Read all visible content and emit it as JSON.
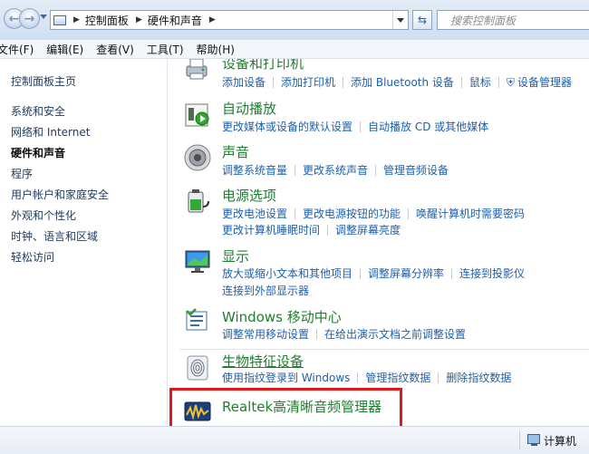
{
  "address": {
    "breadcrumbs": [
      "控制面板",
      "硬件和声音"
    ],
    "search_placeholder": "搜索控制面板"
  },
  "menu": [
    "文件(F)",
    "编辑(E)",
    "查看(V)",
    "工具(T)",
    "帮助(H)"
  ],
  "sidebar": {
    "items": [
      {
        "label": "控制面板主页"
      },
      {
        "label": "系统和安全"
      },
      {
        "label": "网络和 Internet"
      },
      {
        "label": "硬件和声音",
        "active": true
      },
      {
        "label": "程序"
      },
      {
        "label": "用户帐户和家庭安全"
      },
      {
        "label": "外观和个性化"
      },
      {
        "label": "时钟、语言和区域"
      },
      {
        "label": "轻松访问"
      }
    ]
  },
  "categories": [
    {
      "title": "设备和打印机",
      "icon": "printer-icon",
      "rows": [
        [
          "添加设备",
          "添加打印机",
          "添加 Bluetooth 设备",
          "鼠标",
          "设备管理器"
        ]
      ]
    },
    {
      "title": "自动播放",
      "icon": "autoplay-icon",
      "rows": [
        [
          "更改媒体或设备的默认设置",
          "自动播放 CD 或其他媒体"
        ]
      ]
    },
    {
      "title": "声音",
      "icon": "speaker-icon",
      "rows": [
        [
          "调整系统音量",
          "更改系统声音",
          "管理音频设备"
        ]
      ]
    },
    {
      "title": "电源选项",
      "icon": "battery-icon",
      "rows": [
        [
          "更改电池设置",
          "更改电源按钮的功能",
          "唤醒计算机时需要密码"
        ],
        [
          "更改计算机睡眠时间",
          "调整屏幕亮度"
        ]
      ]
    },
    {
      "title": "显示",
      "icon": "monitor-icon",
      "rows": [
        [
          "放大或缩小文本和其他项目",
          "调整屏幕分辨率",
          "连接到投影仪"
        ],
        [
          "连接到外部显示器"
        ]
      ]
    },
    {
      "title": "Windows 移动中心",
      "icon": "mobility-center-icon",
      "rows": [
        [
          "调整常用移动设置",
          "在给出演示文档之前调整设置"
        ]
      ]
    },
    {
      "title": "生物特征设备",
      "icon": "fingerprint-icon",
      "rows": [
        [
          "使用指纹登录到 Windows",
          "管理指纹数据",
          "删除指纹数据"
        ]
      ]
    },
    {
      "title": "Realtek高清晰音频管理器",
      "icon": "realtek-audio-icon",
      "rows": []
    }
  ],
  "status": {
    "location": "计算机"
  },
  "colors": {
    "link": "#1f5fa8",
    "category_title": "#1e7f2f",
    "highlight_box": "#e0191a"
  }
}
